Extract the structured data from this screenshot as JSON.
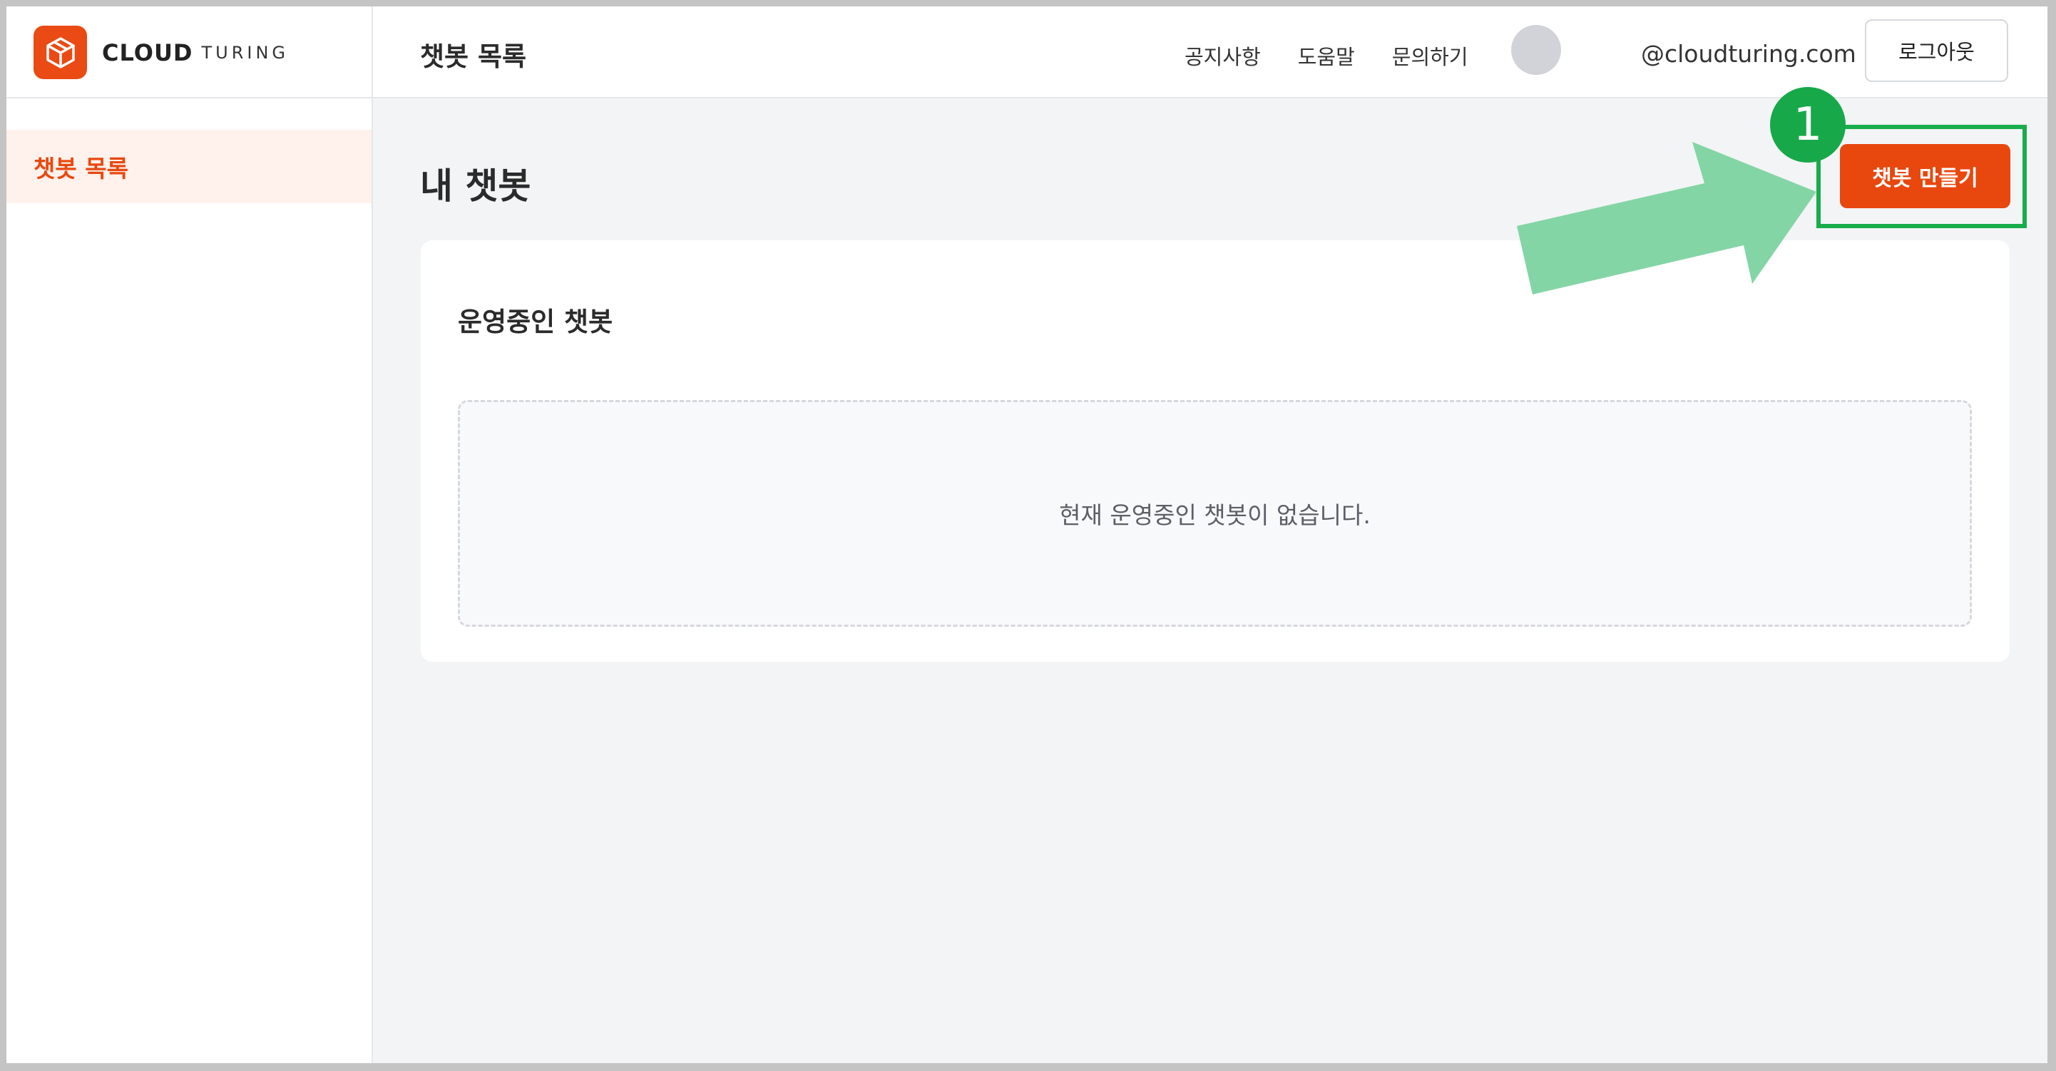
{
  "logo": {
    "bold_text": "CLOUD",
    "light_text": "TURING",
    "brand_color": "#ea4a14",
    "icon": "cube-icon"
  },
  "header": {
    "title": "챗봇 목록",
    "nav": [
      {
        "label": "공지사항"
      },
      {
        "label": "도움말"
      },
      {
        "label": "문의하기"
      }
    ],
    "email": "@cloudturing.com",
    "logout_label": "로그아웃"
  },
  "sidebar": {
    "items": [
      {
        "label": "챗봇 목록",
        "active": true
      }
    ]
  },
  "main": {
    "heading": "내 챗봇",
    "create_button_label": "챗봇 만들기",
    "section_title": "운영중인 챗봇",
    "empty_message": "현재 운영중인 챗봇이 없습니다."
  },
  "annotation": {
    "step_number": "1",
    "color": "#18ad4b",
    "arrow_color": "#7dd3a0"
  },
  "colors": {
    "accent": "#e8470d",
    "sidebar_active_bg": "#fff1ec",
    "page_bg": "#f3f4f6"
  }
}
